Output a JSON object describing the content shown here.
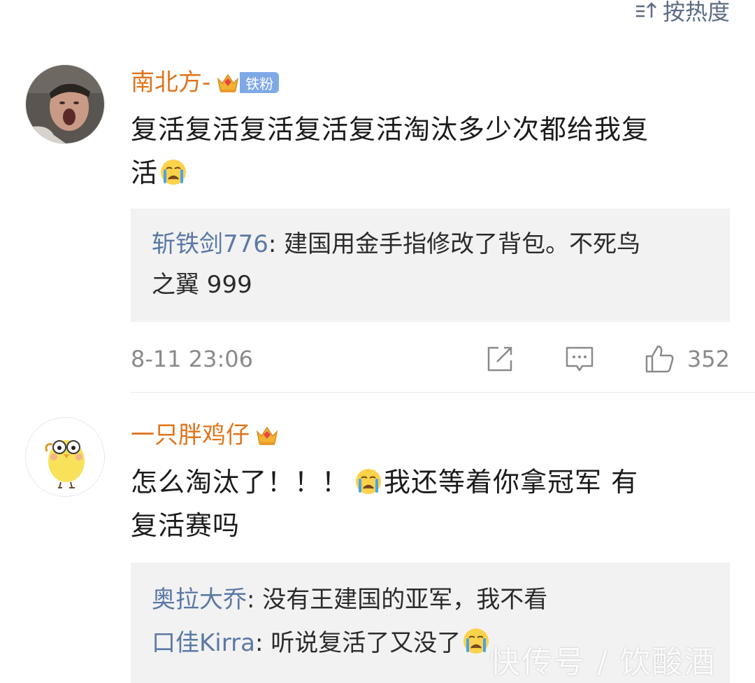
{
  "sort": {
    "label": "按热度",
    "icon": "sort-icon"
  },
  "comments": [
    {
      "username": "南北方-",
      "badge": "铁粉",
      "text_line1": "复活复活复活复活复活淘汰多少次都给我复",
      "text_line2": "活",
      "emoji": "crying-emoji",
      "replies": [
        {
          "name": "斩铁剑776",
          "text": "建国用金手指修改了背包。不死鸟"
        },
        {
          "name": "",
          "text": "之翼 999"
        }
      ],
      "timestamp": "8-11 23:06",
      "likes": "352"
    },
    {
      "username": "一只胖鸡仔",
      "text_line1a": "怎么淘汰了！！！",
      "text_line1b": "我还等着你拿冠军 有",
      "text_line2": "复活赛吗",
      "emoji": "crying-emoji",
      "replies": [
        {
          "name": "奥拉大乔",
          "text": "没有王建国的亚军，我不看"
        },
        {
          "name": "口佳Kirra",
          "text": "听说复活了又没了"
        }
      ]
    }
  ],
  "watermark": "快传号 / 饮酸酒",
  "colors": {
    "username": "#e0741b",
    "reply_name": "#5a79a5",
    "badge": "#7fa9e6",
    "reply_bg": "#f2f2f2"
  }
}
